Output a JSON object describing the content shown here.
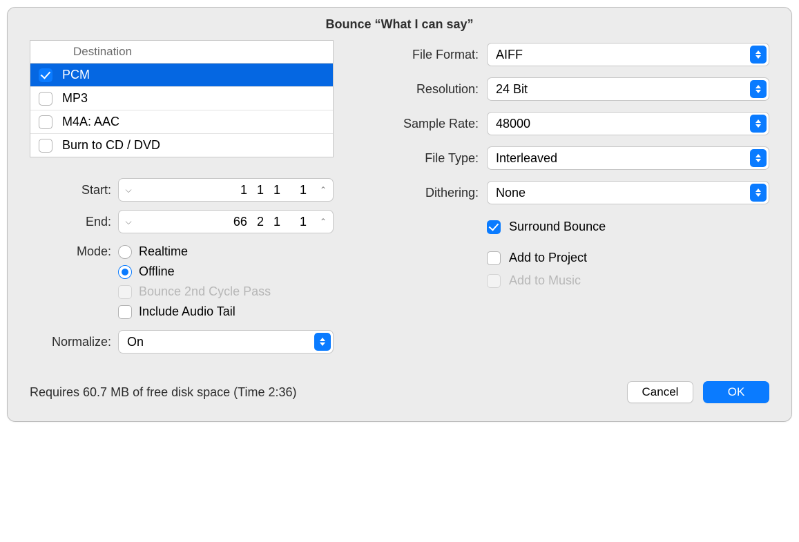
{
  "title": "Bounce “What I can say”",
  "left": {
    "destination_header": "Destination",
    "destinations": [
      {
        "label": "PCM",
        "checked": true,
        "selected": true
      },
      {
        "label": "MP3",
        "checked": false,
        "selected": false
      },
      {
        "label": "M4A: AAC",
        "checked": false,
        "selected": false
      },
      {
        "label": "Burn to CD / DVD",
        "checked": false,
        "selected": false
      }
    ],
    "start_label": "Start:",
    "start_values": {
      "a": "1",
      "b": "1",
      "c": "1",
      "d": "1"
    },
    "end_label": "End:",
    "end_values": {
      "a": "66",
      "b": "2",
      "c": "1",
      "d": "1"
    },
    "mode_label": "Mode:",
    "mode": {
      "realtime": "Realtime",
      "offline": "Offline",
      "bounce2": "Bounce 2nd Cycle Pass",
      "include_tail": "Include Audio Tail"
    },
    "normalize_label": "Normalize:",
    "normalize_value": "On"
  },
  "right": {
    "file_format_label": "File Format:",
    "file_format_value": "AIFF",
    "resolution_label": "Resolution:",
    "resolution_value": "24 Bit",
    "sample_rate_label": "Sample Rate:",
    "sample_rate_value": "48000",
    "file_type_label": "File Type:",
    "file_type_value": "Interleaved",
    "dithering_label": "Dithering:",
    "dithering_value": "None",
    "surround_bounce": "Surround Bounce",
    "add_to_project": "Add to Project",
    "add_to_music": "Add to Music"
  },
  "footer": {
    "status": "Requires 60.7 MB of free disk space  (Time 2:36)",
    "cancel": "Cancel",
    "ok": "OK"
  }
}
